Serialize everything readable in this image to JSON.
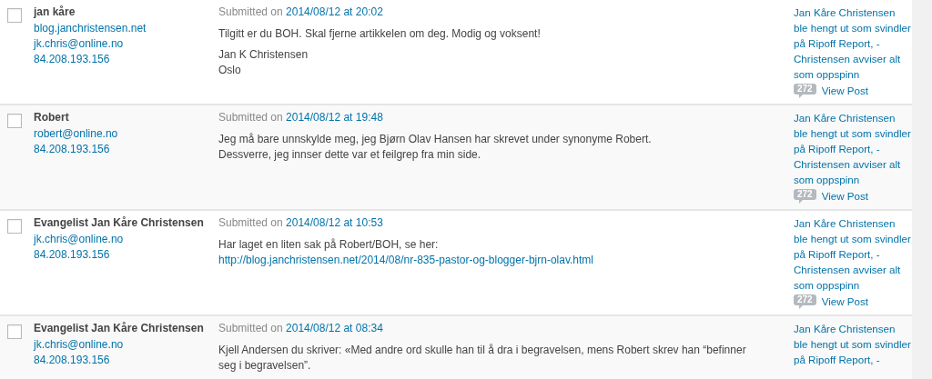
{
  "comments": [
    {
      "selected": false,
      "author": {
        "name": "jan kåre",
        "url": "blog.janchristensen.net",
        "email": "jk.chris@online.no",
        "ip": "84.208.193.156"
      },
      "submitted": {
        "label": "Submitted on",
        "date": "2014/08/12 at 20:02"
      },
      "paragraphs": [
        [
          {
            "kind": "text",
            "text": "Tilgitt er du BOH. Skal fjerne artikkelen om deg. Modig og voksent!"
          }
        ],
        [
          {
            "kind": "text",
            "text": "Jan K Christensen"
          },
          {
            "kind": "text",
            "text": "Oslo"
          }
        ]
      ],
      "response": {
        "title": "Jan Kåre Christensen ble hengt ut som svindler på Ripoff Report, - Christensen avviser alt som oppspinn",
        "count": "272",
        "view": "View Post"
      }
    },
    {
      "selected": false,
      "author": {
        "name": "Robert",
        "email": "robert@online.no",
        "ip": "84.208.193.156"
      },
      "submitted": {
        "label": "Submitted on",
        "date": "2014/08/12 at 19:48"
      },
      "paragraphs": [
        [
          {
            "kind": "text",
            "text": "Jeg må bare unnskylde meg, jeg Bjørn Olav Hansen har skrevet under synonyme Robert."
          },
          {
            "kind": "text",
            "text": "Dessverre, jeg innser dette var et feilgrep fra min side."
          }
        ]
      ],
      "response": {
        "title": "Jan Kåre Christensen ble hengt ut som svindler på Ripoff Report, - Christensen avviser alt som oppspinn",
        "count": "272",
        "view": "View Post"
      }
    },
    {
      "selected": false,
      "author": {
        "name": "Evangelist Jan Kåre Christensen",
        "email": "jk.chris@online.no",
        "ip": "84.208.193.156"
      },
      "submitted": {
        "label": "Submitted on",
        "date": "2014/08/12 at 10:53"
      },
      "paragraphs": [
        [
          {
            "kind": "text",
            "text": "Har laget en liten sak på Robert/BOH, se her:"
          },
          {
            "kind": "link",
            "text": "http://blog.janchristensen.net/2014/08/nr-835-pastor-og-blogger-bjrn-olav.html"
          }
        ]
      ],
      "response": {
        "title": "Jan Kåre Christensen ble hengt ut som svindler på Ripoff Report, - Christensen avviser alt som oppspinn",
        "count": "272",
        "view": "View Post"
      }
    },
    {
      "selected": false,
      "author": {
        "name": "Evangelist Jan Kåre Christensen",
        "email": "jk.chris@online.no",
        "ip": "84.208.193.156"
      },
      "submitted": {
        "label": "Submitted on",
        "date": "2014/08/12 at 08:34"
      },
      "paragraphs": [
        [
          {
            "kind": "text",
            "text": "Kjell Andersen du skriver: «Med andre ord skulle han til å dra i begravelsen, mens Robert skrev han “befinner"
          },
          {
            "kind": "text",
            "text": "seg i begravelsen”."
          }
        ]
      ],
      "response": {
        "title": "Jan Kåre Christensen ble hengt ut som svindler på Ripoff Report, -"
      }
    }
  ]
}
